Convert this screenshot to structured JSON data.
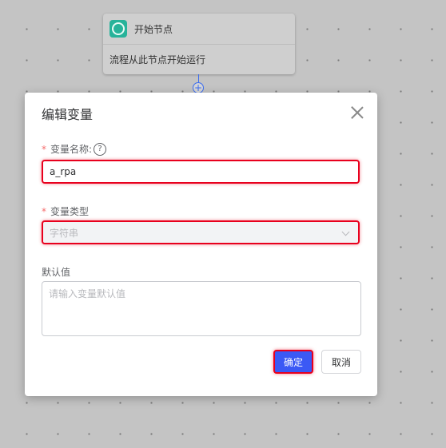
{
  "canvas": {
    "start_node": {
      "title": "开始节点",
      "description": "流程从此节点开始运行",
      "icon": "start-node-icon",
      "accent": "#27b39a"
    },
    "add_icon": "+"
  },
  "dialog": {
    "title": "编辑变量",
    "close_icon": "close-icon",
    "fields": {
      "name": {
        "required_mark": "*",
        "label": "变量名称:",
        "help": "?",
        "value": "a_rpa"
      },
      "type": {
        "required_mark": "*",
        "label": "变量类型",
        "value": "字符串",
        "disabled": true
      },
      "default": {
        "label": "默认值",
        "placeholder": "请输入变量默认值",
        "value": ""
      }
    },
    "buttons": {
      "confirm": "确定",
      "cancel": "取消"
    }
  },
  "colors": {
    "primary": "#3b59f5",
    "highlight": "#e8001d",
    "required": "#f56c6c"
  }
}
